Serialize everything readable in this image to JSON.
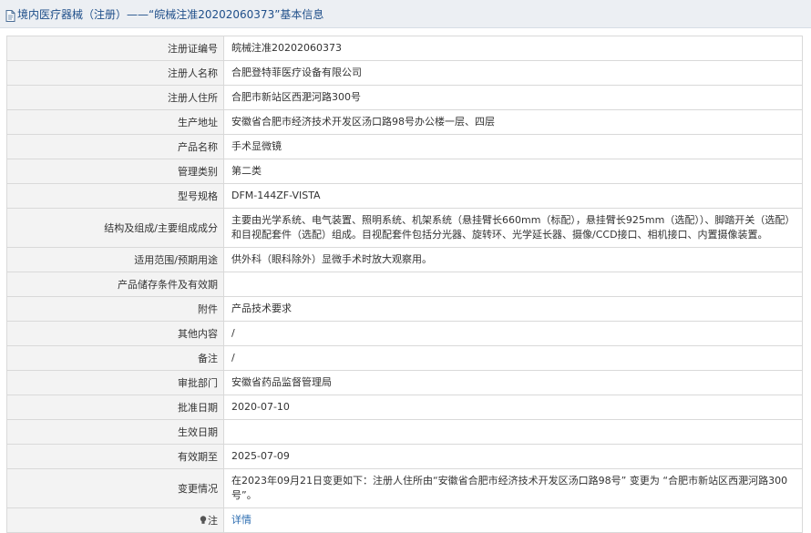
{
  "header": {
    "title": "境内医疗器械（注册）——“皖械注准20202060373”基本信息"
  },
  "rows": {
    "reg_no": {
      "label": "注册证编号",
      "value": "皖械注准20202060373"
    },
    "registrant": {
      "label": "注册人名称",
      "value": "合肥登特菲医疗设备有限公司"
    },
    "residence": {
      "label": "注册人住所",
      "value": "合肥市新站区西淝河路300号"
    },
    "production": {
      "label": "生产地址",
      "value": "安徽省合肥市经济技术开发区汤口路98号办公楼一层、四层"
    },
    "product_name": {
      "label": "产品名称",
      "value": "手术显微镜"
    },
    "class": {
      "label": "管理类别",
      "value": "第二类"
    },
    "model": {
      "label": "型号规格",
      "value": "DFM-144ZF-VISTA"
    },
    "structure": {
      "label": "结构及组成/主要组成成分",
      "value": "主要由光学系统、电气装置、照明系统、机架系统（悬挂臂长660mm（标配），悬挂臂长925mm（选配））、脚踏开关（选配）和目视配套件（选配）组成。目视配套件包括分光器、旋转环、光学延长器、摄像/CCD接口、相机接口、内置摄像装置。"
    },
    "scope": {
      "label": "适用范围/预期用途",
      "value": "供外科（眼科除外）显微手术时放大观察用。"
    },
    "storage": {
      "label": "产品储存条件及有效期",
      "value": ""
    },
    "attachment": {
      "label": "附件",
      "value": "产品技术要求"
    },
    "other": {
      "label": "其他内容",
      "value": "/"
    },
    "remark": {
      "label": "备注",
      "value": "/"
    },
    "approver": {
      "label": "审批部门",
      "value": "安徽省药品监督管理局"
    },
    "approve_date": {
      "label": "批准日期",
      "value": "2020-07-10"
    },
    "effective": {
      "label": "生效日期",
      "value": ""
    },
    "expire": {
      "label": "有效期至",
      "value": "2025-07-09"
    },
    "change": {
      "label": "变更情况",
      "value": "在2023年09月21日变更如下：注册人住所由“安徽省合肥市经济技术开发区汤口路98号” 变更为 “合肥市新站区西淝河路300号”。"
    },
    "note": {
      "label": "注",
      "value": "详情"
    }
  },
  "icons": {
    "header": "document-icon",
    "note": "lightbulb-icon"
  },
  "colors": {
    "title": "#1f4f8a",
    "link": "#2b6cb0",
    "label_bg": "#f3f3f3",
    "border": "#d9d9d9"
  }
}
